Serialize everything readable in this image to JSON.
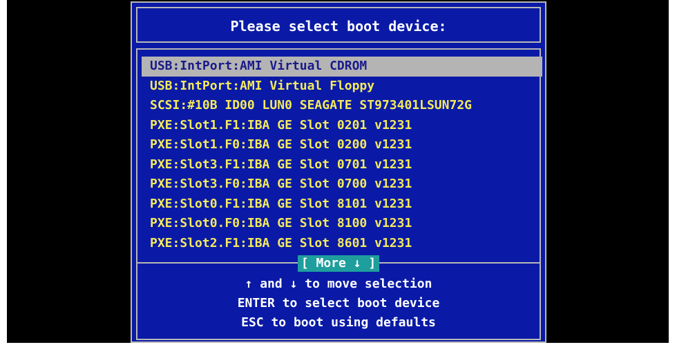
{
  "title": "Please select boot device:",
  "devices": [
    {
      "label": "USB:IntPort:AMI Virtual CDROM",
      "selected": true
    },
    {
      "label": "USB:IntPort:AMI Virtual Floppy",
      "selected": false
    },
    {
      "label": "SCSI:#10B ID00 LUN0 SEAGATE ST973401LSUN72G",
      "selected": false
    },
    {
      "label": "PXE:Slot1.F1:IBA GE Slot 0201 v1231",
      "selected": false
    },
    {
      "label": "PXE:Slot1.F0:IBA GE Slot 0200 v1231",
      "selected": false
    },
    {
      "label": "PXE:Slot3.F1:IBA GE Slot 0701 v1231",
      "selected": false
    },
    {
      "label": "PXE:Slot3.F0:IBA GE Slot 0700 v1231",
      "selected": false
    },
    {
      "label": "PXE:Slot0.F1:IBA GE Slot 8101 v1231",
      "selected": false
    },
    {
      "label": "PXE:Slot0.F0:IBA GE Slot 8100 v1231",
      "selected": false
    },
    {
      "label": "PXE:Slot2.F1:IBA GE Slot 8601 v1231",
      "selected": false
    }
  ],
  "more_label": "[ More ↓ ]",
  "help": {
    "move": "↑ and ↓ to move selection",
    "enter": "ENTER to select boot device",
    "esc": "ESC to boot using defaults"
  },
  "colors": {
    "background": "#0a1aa6",
    "border": "#b8b8b8",
    "item_text": "#f4ea5c",
    "selected_bg": "#b4b4b4",
    "selected_text": "#1a1a8a",
    "more_bg": "#1f9e9e",
    "help_text": "#ffffff"
  }
}
